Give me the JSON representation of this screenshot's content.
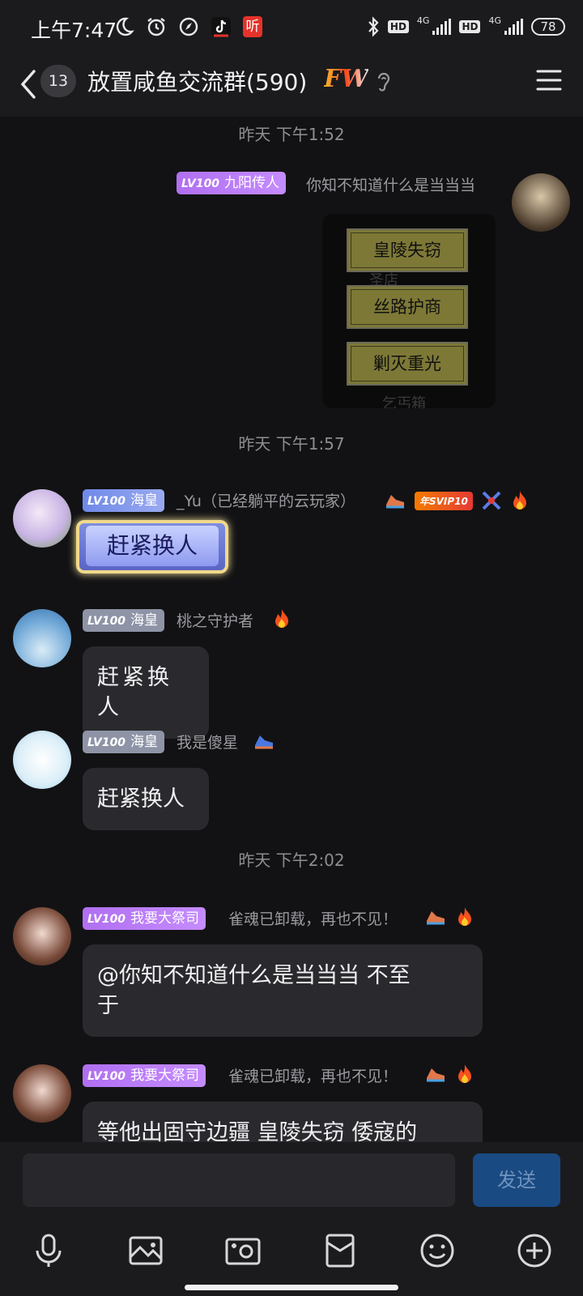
{
  "status_bar": {
    "time": "上午7:47",
    "ting_label": "听",
    "hd1": "HD",
    "net1": "4G",
    "hd2": "HD",
    "net2": "4G",
    "battery": "78"
  },
  "header": {
    "unread_count": "13",
    "title": "放置咸鱼交流群(590)",
    "badge": "FW"
  },
  "chat": {
    "messages": [
      {
        "timestamp": "昨天 下午1:52"
      },
      {
        "level": "LV100",
        "title": "九阳传人",
        "nickname": "你知不知道什么是当当当",
        "card_buttons": [
          "皇陵失窃",
          "丝路护商",
          "剿灭重光"
        ],
        "card_faint_text": [
          "圣店",
          "乞丐箱"
        ]
      },
      {
        "timestamp": "昨天 下午1:57"
      },
      {
        "level": "LV100",
        "title": "海皇",
        "nickname": "_Yu（已经躺平的云玩家）",
        "sticker_text": "赶紧换人",
        "svip_label": "年SVIP10"
      },
      {
        "level": "LV100",
        "title": "海皇",
        "nickname": "桃之守护者",
        "text": "赶紧换人"
      },
      {
        "level": "LV100",
        "title": "海皇",
        "nickname": "我是傻星",
        "text": "赶紧换人"
      },
      {
        "timestamp": "昨天 下午2:02"
      },
      {
        "level": "LV100",
        "title": "我要大祭司",
        "nickname": "雀魂已卸载，再也不见！",
        "text_line1": "@你知不知道什么是当当当 不至",
        "text_line2": "于"
      },
      {
        "level": "LV100",
        "title": "我要大祭司",
        "nickname": "雀魂已卸载，再也不见！",
        "text": "等他出固守边疆 皇陵失窃 倭寇的"
      }
    ]
  },
  "composer": {
    "input_value": "",
    "send_label": "发送"
  },
  "icons": [
    "back-icon",
    "ear-icon",
    "menu-icon",
    "microphone-icon",
    "image-icon",
    "camera-icon",
    "red-packet-icon",
    "emoji-icon",
    "plus-icon"
  ]
}
